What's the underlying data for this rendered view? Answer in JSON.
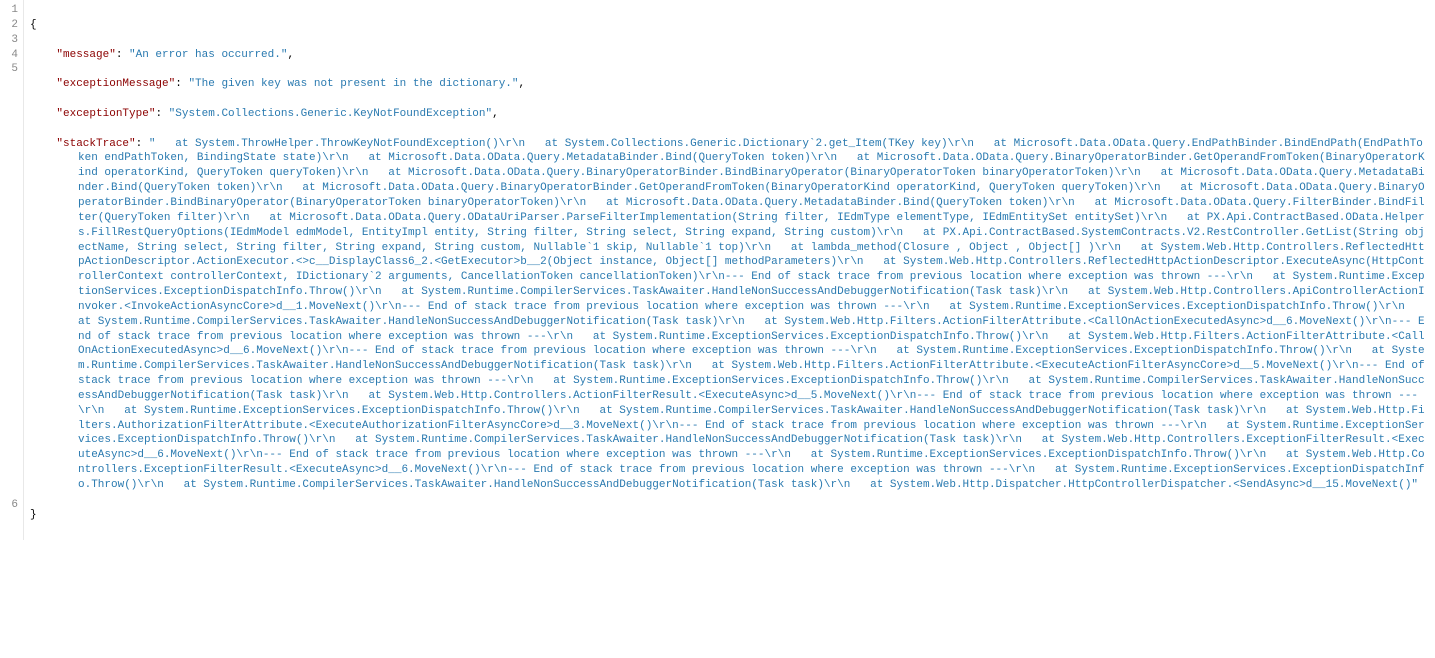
{
  "gutter": {
    "1": "1",
    "2": "2",
    "3": "3",
    "4": "4",
    "5": "5",
    "6": "6"
  },
  "json": {
    "open_brace": "{",
    "close_brace": "}",
    "indent": "    ",
    "key_message": "\"message\"",
    "val_message": "\"An error has occurred.\"",
    "key_exceptionMessage": "\"exceptionMessage\"",
    "val_exceptionMessage": "\"The given key was not present in the dictionary.\"",
    "key_exceptionType": "\"exceptionType\"",
    "val_exceptionType": "\"System.Collections.Generic.KeyNotFoundException\"",
    "key_stackTrace": "\"stackTrace\"",
    "val_stackTrace": "\"   at System.ThrowHelper.ThrowKeyNotFoundException()\\r\\n   at System.Collections.Generic.Dictionary`2.get_Item(TKey key)\\r\\n   at Microsoft.Data.OData.Query.EndPathBinder.BindEndPath(EndPathToken endPathToken, BindingState state)\\r\\n   at Microsoft.Data.OData.Query.MetadataBinder.Bind(QueryToken token)\\r\\n   at Microsoft.Data.OData.Query.BinaryOperatorBinder.GetOperandFromToken(BinaryOperatorKind operatorKind, QueryToken queryToken)\\r\\n   at Microsoft.Data.OData.Query.BinaryOperatorBinder.BindBinaryOperator(BinaryOperatorToken binaryOperatorToken)\\r\\n   at Microsoft.Data.OData.Query.MetadataBinder.Bind(QueryToken token)\\r\\n   at Microsoft.Data.OData.Query.BinaryOperatorBinder.GetOperandFromToken(BinaryOperatorKind operatorKind, QueryToken queryToken)\\r\\n   at Microsoft.Data.OData.Query.BinaryOperatorBinder.BindBinaryOperator(BinaryOperatorToken binaryOperatorToken)\\r\\n   at Microsoft.Data.OData.Query.MetadataBinder.Bind(QueryToken token)\\r\\n   at Microsoft.Data.OData.Query.FilterBinder.BindFilter(QueryToken filter)\\r\\n   at Microsoft.Data.OData.Query.ODataUriParser.ParseFilterImplementation(String filter, IEdmType elementType, IEdmEntitySet entitySet)\\r\\n   at PX.Api.ContractBased.OData.Helpers.FillRestQueryOptions(IEdmModel edmModel, EntityImpl entity, String filter, String select, String expand, String custom)\\r\\n   at PX.Api.ContractBased.SystemContracts.V2.RestController.GetList(String objectName, String select, String filter, String expand, String custom, Nullable`1 skip, Nullable`1 top)\\r\\n   at lambda_method(Closure , Object , Object[] )\\r\\n   at System.Web.Http.Controllers.ReflectedHttpActionDescriptor.ActionExecutor.<>c__DisplayClass6_2.<GetExecutor>b__2(Object instance, Object[] methodParameters)\\r\\n   at System.Web.Http.Controllers.ReflectedHttpActionDescriptor.ExecuteAsync(HttpControllerContext controllerContext, IDictionary`2 arguments, CancellationToken cancellationToken)\\r\\n--- End of stack trace from previous location where exception was thrown ---\\r\\n   at System.Runtime.ExceptionServices.ExceptionDispatchInfo.Throw()\\r\\n   at System.Runtime.CompilerServices.TaskAwaiter.HandleNonSuccessAndDebuggerNotification(Task task)\\r\\n   at System.Web.Http.Controllers.ApiControllerActionInvoker.<InvokeActionAsyncCore>d__1.MoveNext()\\r\\n--- End of stack trace from previous location where exception was thrown ---\\r\\n   at System.Runtime.ExceptionServices.ExceptionDispatchInfo.Throw()\\r\\n   at System.Runtime.CompilerServices.TaskAwaiter.HandleNonSuccessAndDebuggerNotification(Task task)\\r\\n   at System.Web.Http.Filters.ActionFilterAttribute.<CallOnActionExecutedAsync>d__6.MoveNext()\\r\\n--- End of stack trace from previous location where exception was thrown ---\\r\\n   at System.Runtime.ExceptionServices.ExceptionDispatchInfo.Throw()\\r\\n   at System.Web.Http.Filters.ActionFilterAttribute.<CallOnActionExecutedAsync>d__6.MoveNext()\\r\\n--- End of stack trace from previous location where exception was thrown ---\\r\\n   at System.Runtime.ExceptionServices.ExceptionDispatchInfo.Throw()\\r\\n   at System.Runtime.CompilerServices.TaskAwaiter.HandleNonSuccessAndDebuggerNotification(Task task)\\r\\n   at System.Web.Http.Filters.ActionFilterAttribute.<ExecuteActionFilterAsyncCore>d__5.MoveNext()\\r\\n--- End of stack trace from previous location where exception was thrown ---\\r\\n   at System.Runtime.ExceptionServices.ExceptionDispatchInfo.Throw()\\r\\n   at System.Runtime.CompilerServices.TaskAwaiter.HandleNonSuccessAndDebuggerNotification(Task task)\\r\\n   at System.Web.Http.Controllers.ActionFilterResult.<ExecuteAsync>d__5.MoveNext()\\r\\n--- End of stack trace from previous location where exception was thrown ---\\r\\n   at System.Runtime.ExceptionServices.ExceptionDispatchInfo.Throw()\\r\\n   at System.Runtime.CompilerServices.TaskAwaiter.HandleNonSuccessAndDebuggerNotification(Task task)\\r\\n   at System.Web.Http.Filters.AuthorizationFilterAttribute.<ExecuteAuthorizationFilterAsyncCore>d__3.MoveNext()\\r\\n--- End of stack trace from previous location where exception was thrown ---\\r\\n   at System.Runtime.ExceptionServices.ExceptionDispatchInfo.Throw()\\r\\n   at System.Runtime.CompilerServices.TaskAwaiter.HandleNonSuccessAndDebuggerNotification(Task task)\\r\\n   at System.Web.Http.Controllers.ExceptionFilterResult.<ExecuteAsync>d__6.MoveNext()\\r\\n--- End of stack trace from previous location where exception was thrown ---\\r\\n   at System.Runtime.ExceptionServices.ExceptionDispatchInfo.Throw()\\r\\n   at System.Web.Http.Controllers.ExceptionFilterResult.<ExecuteAsync>d__6.MoveNext()\\r\\n--- End of stack trace from previous location where exception was thrown ---\\r\\n   at System.Runtime.ExceptionServices.ExceptionDispatchInfo.Throw()\\r\\n   at System.Runtime.CompilerServices.TaskAwaiter.HandleNonSuccessAndDebuggerNotification(Task task)\\r\\n   at System.Web.Http.Dispatcher.HttpControllerDispatcher.<SendAsync>d__15.MoveNext()\"",
    "colon": ": ",
    "comma": ","
  }
}
